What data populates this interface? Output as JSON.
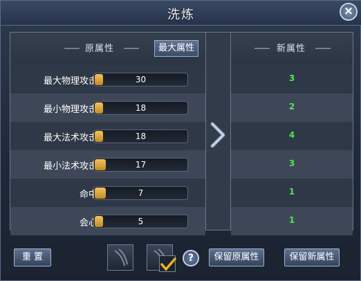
{
  "window": {
    "title": "洗炼"
  },
  "header": {
    "original_label": "原属性",
    "max_button_label": "最大属性",
    "new_label": "新属性"
  },
  "rows": [
    {
      "name": "最大物理攻击",
      "value": "30",
      "fill": 0.08,
      "new_value": "3"
    },
    {
      "name": "最小物理攻击",
      "value": "18",
      "fill": 0.08,
      "new_value": "2"
    },
    {
      "name": "最大法术攻击",
      "value": "18",
      "fill": 0.08,
      "new_value": "4"
    },
    {
      "name": "最小法术攻击",
      "value": "17",
      "fill": 0.12,
      "new_value": "3"
    },
    {
      "name": "命中",
      "value": "7",
      "fill": 0.12,
      "new_value": "1"
    },
    {
      "name": "会心",
      "value": "5",
      "fill": 0.08,
      "new_value": "1"
    }
  ],
  "bottom": {
    "reset_label": "重 置",
    "keep_original_label": "保留原属性",
    "keep_new_label": "保留新属性",
    "help_label": "?"
  },
  "checkbox_checked": true,
  "colors": {
    "new_value": "#4ee64e",
    "bar_fill": "#e0a63a",
    "check": "#f0b21c"
  }
}
